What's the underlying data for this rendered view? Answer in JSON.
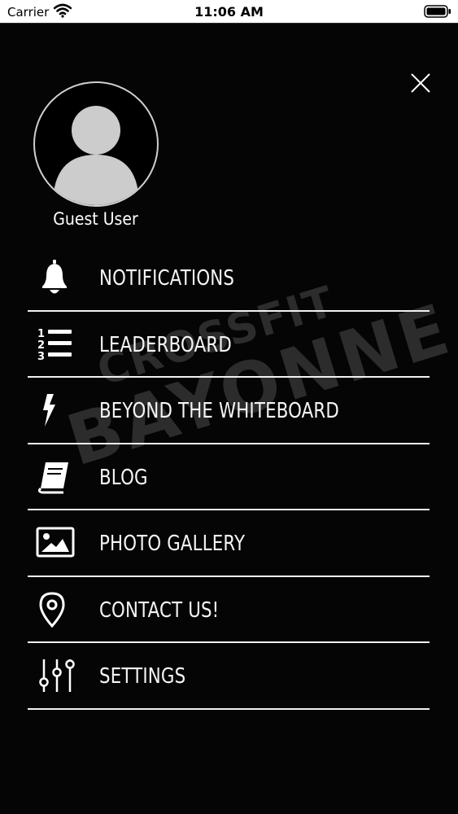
{
  "status_bar": {
    "carrier": "Carrier",
    "time": "11:06 AM"
  },
  "watermark": {
    "line1": "CROSSFIT",
    "line2": "BAYONNE"
  },
  "profile": {
    "name": "Guest User"
  },
  "menu": {
    "items": [
      {
        "label": "NOTIFICATIONS",
        "icon": "bell-icon"
      },
      {
        "label": "LEADERBOARD",
        "icon": "ranked-list-icon"
      },
      {
        "label": "BEYOND THE WHITEBOARD",
        "icon": "lightning-bolt-icon"
      },
      {
        "label": "BLOG",
        "icon": "book-icon"
      },
      {
        "label": "PHOTO GALLERY",
        "icon": "image-icon"
      },
      {
        "label": "CONTACT US!",
        "icon": "map-pin-icon"
      },
      {
        "label": "SETTINGS",
        "icon": "sliders-icon"
      }
    ]
  },
  "colors": {
    "background": "#050505",
    "text": "#f5f5f5",
    "divider": "#f2f2f2",
    "avatar": "#cccccc",
    "watermark": "#2c2c2c"
  }
}
